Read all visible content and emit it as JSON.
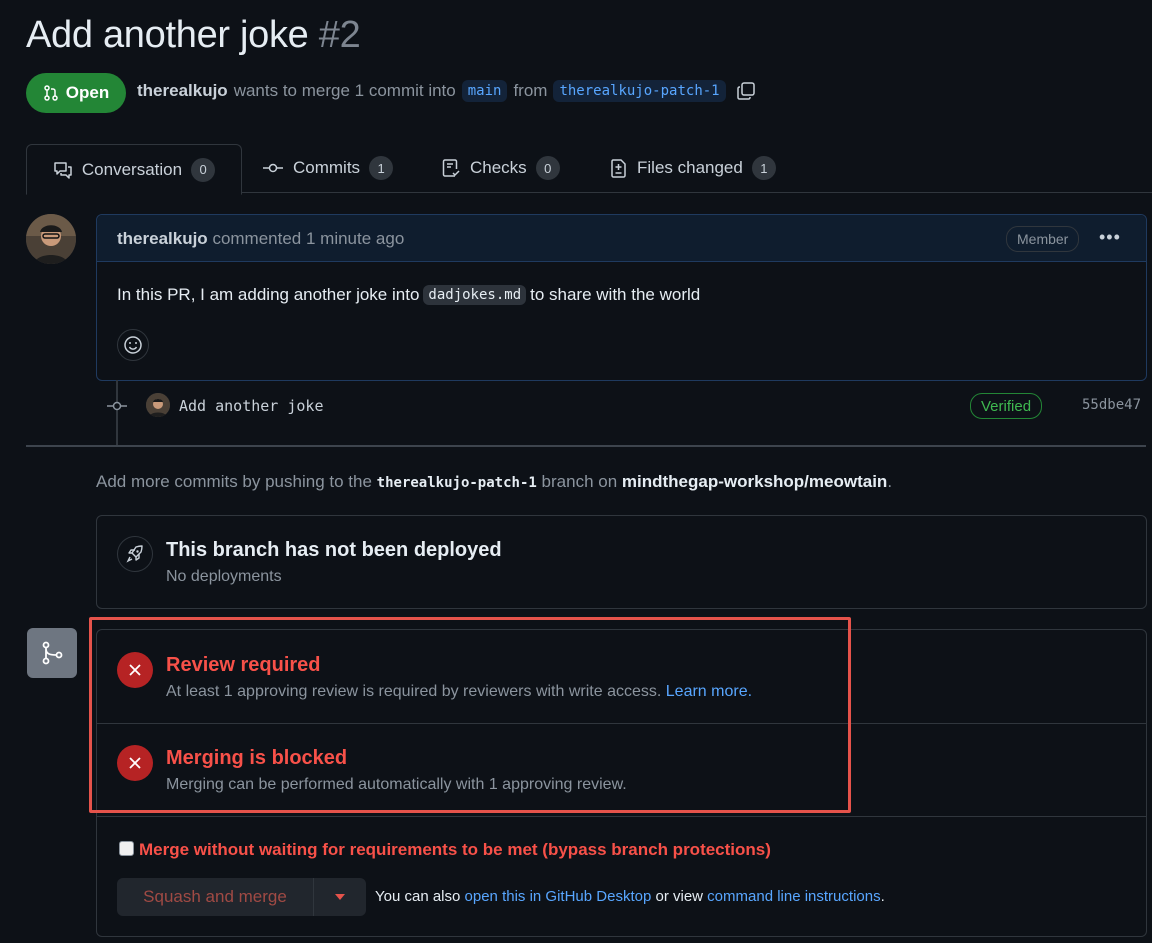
{
  "pr": {
    "title": "Add another joke",
    "number": "#2",
    "state": "Open",
    "author": "therealkujo",
    "merge_text_1": "wants to merge 1 commit into",
    "base_branch": "main",
    "merge_text_2": "from",
    "head_branch": "therealkujo-patch-1"
  },
  "tabs": [
    {
      "label": "Conversation",
      "count": "0"
    },
    {
      "label": "Commits",
      "count": "1"
    },
    {
      "label": "Checks",
      "count": "0"
    },
    {
      "label": "Files changed",
      "count": "1"
    }
  ],
  "comment": {
    "author": "therealkujo",
    "action": "commented 1 minute ago",
    "badge": "Member",
    "body_pre": "In this PR, I am adding another joke into",
    "body_code": "dadjokes.md",
    "body_post": "to share with the world"
  },
  "commit": {
    "message": "Add another joke",
    "verified": "Verified",
    "sha": "55dbe47"
  },
  "info": {
    "pre": "Add more commits by pushing to the",
    "branch": "therealkujo-patch-1",
    "mid": "branch on",
    "repo": "mindthegap-workshop/meowtain",
    "end": "."
  },
  "deploy": {
    "title": "This branch has not been deployed",
    "subtitle": "No deployments"
  },
  "merge": {
    "review_title": "Review required",
    "review_sub": "At least 1 approving review is required by reviewers with write access.",
    "learn_more": "Learn more.",
    "blocked_title": "Merging is blocked",
    "blocked_sub": "Merging can be performed automatically with 1 approving review.",
    "bypass_label": "Merge without waiting for requirements to be met (bypass branch protections)",
    "squash_label": "Squash and merge",
    "also_pre": "You can also",
    "desktop_link": "open this in GitHub Desktop",
    "also_mid": "or view",
    "cli_link": "command line instructions",
    "also_end": "."
  },
  "colors": {
    "open_green": "#238636",
    "danger_red": "#f85149",
    "link_blue": "#58a6ff",
    "highlight_border": "#e5534b"
  }
}
